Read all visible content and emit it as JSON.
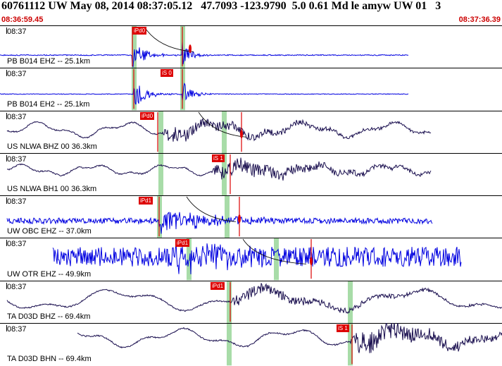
{
  "header": {
    "title": "60761112 UW May 08, 2014 08:37:05.12   47.7093 -123.9790  5.0 0.61 Md le amyw UW 01   3",
    "start_time": "08:36:59.45",
    "end_time": "08:37:36.39"
  },
  "colors": {
    "blue_trace": "#0000e0",
    "dark_trace": "#1a0f4f",
    "pick_red": "#dd0000",
    "window_green": "#a8dca8",
    "time_red": "#cc0000"
  },
  "traces": [
    {
      "time": "08:37",
      "label": "PB B014 EHZ -- 25.1km",
      "pick_label": "iPd0",
      "color_key": "blue_trace"
    },
    {
      "time": "08:37",
      "label": "PB B014 EH2 -- 25.1km",
      "pick_label": "iS 0",
      "color_key": "blue_trace"
    },
    {
      "time": "08:37",
      "label": "US NLWA BHZ 00 36.3km",
      "pick_label": "iPd0",
      "color_key": "dark_trace"
    },
    {
      "time": "08:37",
      "label": "US NLWA BH1 00 36.3km",
      "pick_label": "iS 1",
      "color_key": "dark_trace"
    },
    {
      "time": "08:37",
      "label": "UW OBC EHZ -- 37.0km",
      "pick_label": "iPd1",
      "color_key": "blue_trace"
    },
    {
      "time": "08:37",
      "label": "UW OTR EHZ -- 49.9km",
      "pick_label": "iPd1",
      "color_key": "blue_trace"
    },
    {
      "time": "08:37",
      "label": "TA D03D BHZ -- 69.4km",
      "pick_label": "iPd1",
      "color_key": "dark_trace"
    },
    {
      "time": "08:37",
      "label": "TA D03D BHN -- 69.4km",
      "pick_label": "iS 1",
      "color_key": "dark_trace"
    }
  ]
}
